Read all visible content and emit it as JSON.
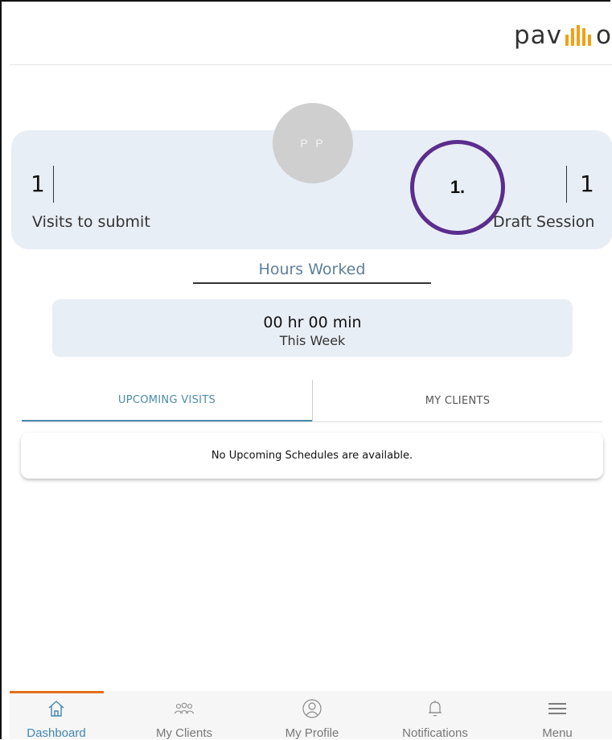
{
  "header": {
    "logo_text_left": "pav",
    "logo_text_right": "o"
  },
  "avatar": {
    "initials": "P P"
  },
  "stats": {
    "visits_to_submit": {
      "value": "1",
      "label": "Visits to submit"
    },
    "draft_session": {
      "value": "1",
      "label": "Draft Session"
    }
  },
  "annotation": {
    "label": "1."
  },
  "hours": {
    "title": "Hours Worked",
    "value": "00 hr 00 min",
    "period": "This Week"
  },
  "tabs": [
    {
      "label": "UPCOMING VISITS",
      "active": true
    },
    {
      "label": "MY CLIENTS",
      "active": false
    }
  ],
  "upcoming": {
    "empty_message": "No Upcoming Schedules are available."
  },
  "nav": [
    {
      "label": "Dashboard",
      "icon": "home-icon",
      "active": true
    },
    {
      "label": "My Clients",
      "icon": "clients-icon",
      "active": false
    },
    {
      "label": "My Profile",
      "icon": "profile-icon",
      "active": false
    },
    {
      "label": "Notifications",
      "icon": "bell-icon",
      "active": false
    },
    {
      "label": "Menu",
      "icon": "hamburger-icon",
      "active": false
    }
  ],
  "colors": {
    "accent": "#4d8cab",
    "brand_orange": "#f2a014",
    "active_nav": "#e2701b",
    "annotation": "#5b2d8e"
  }
}
